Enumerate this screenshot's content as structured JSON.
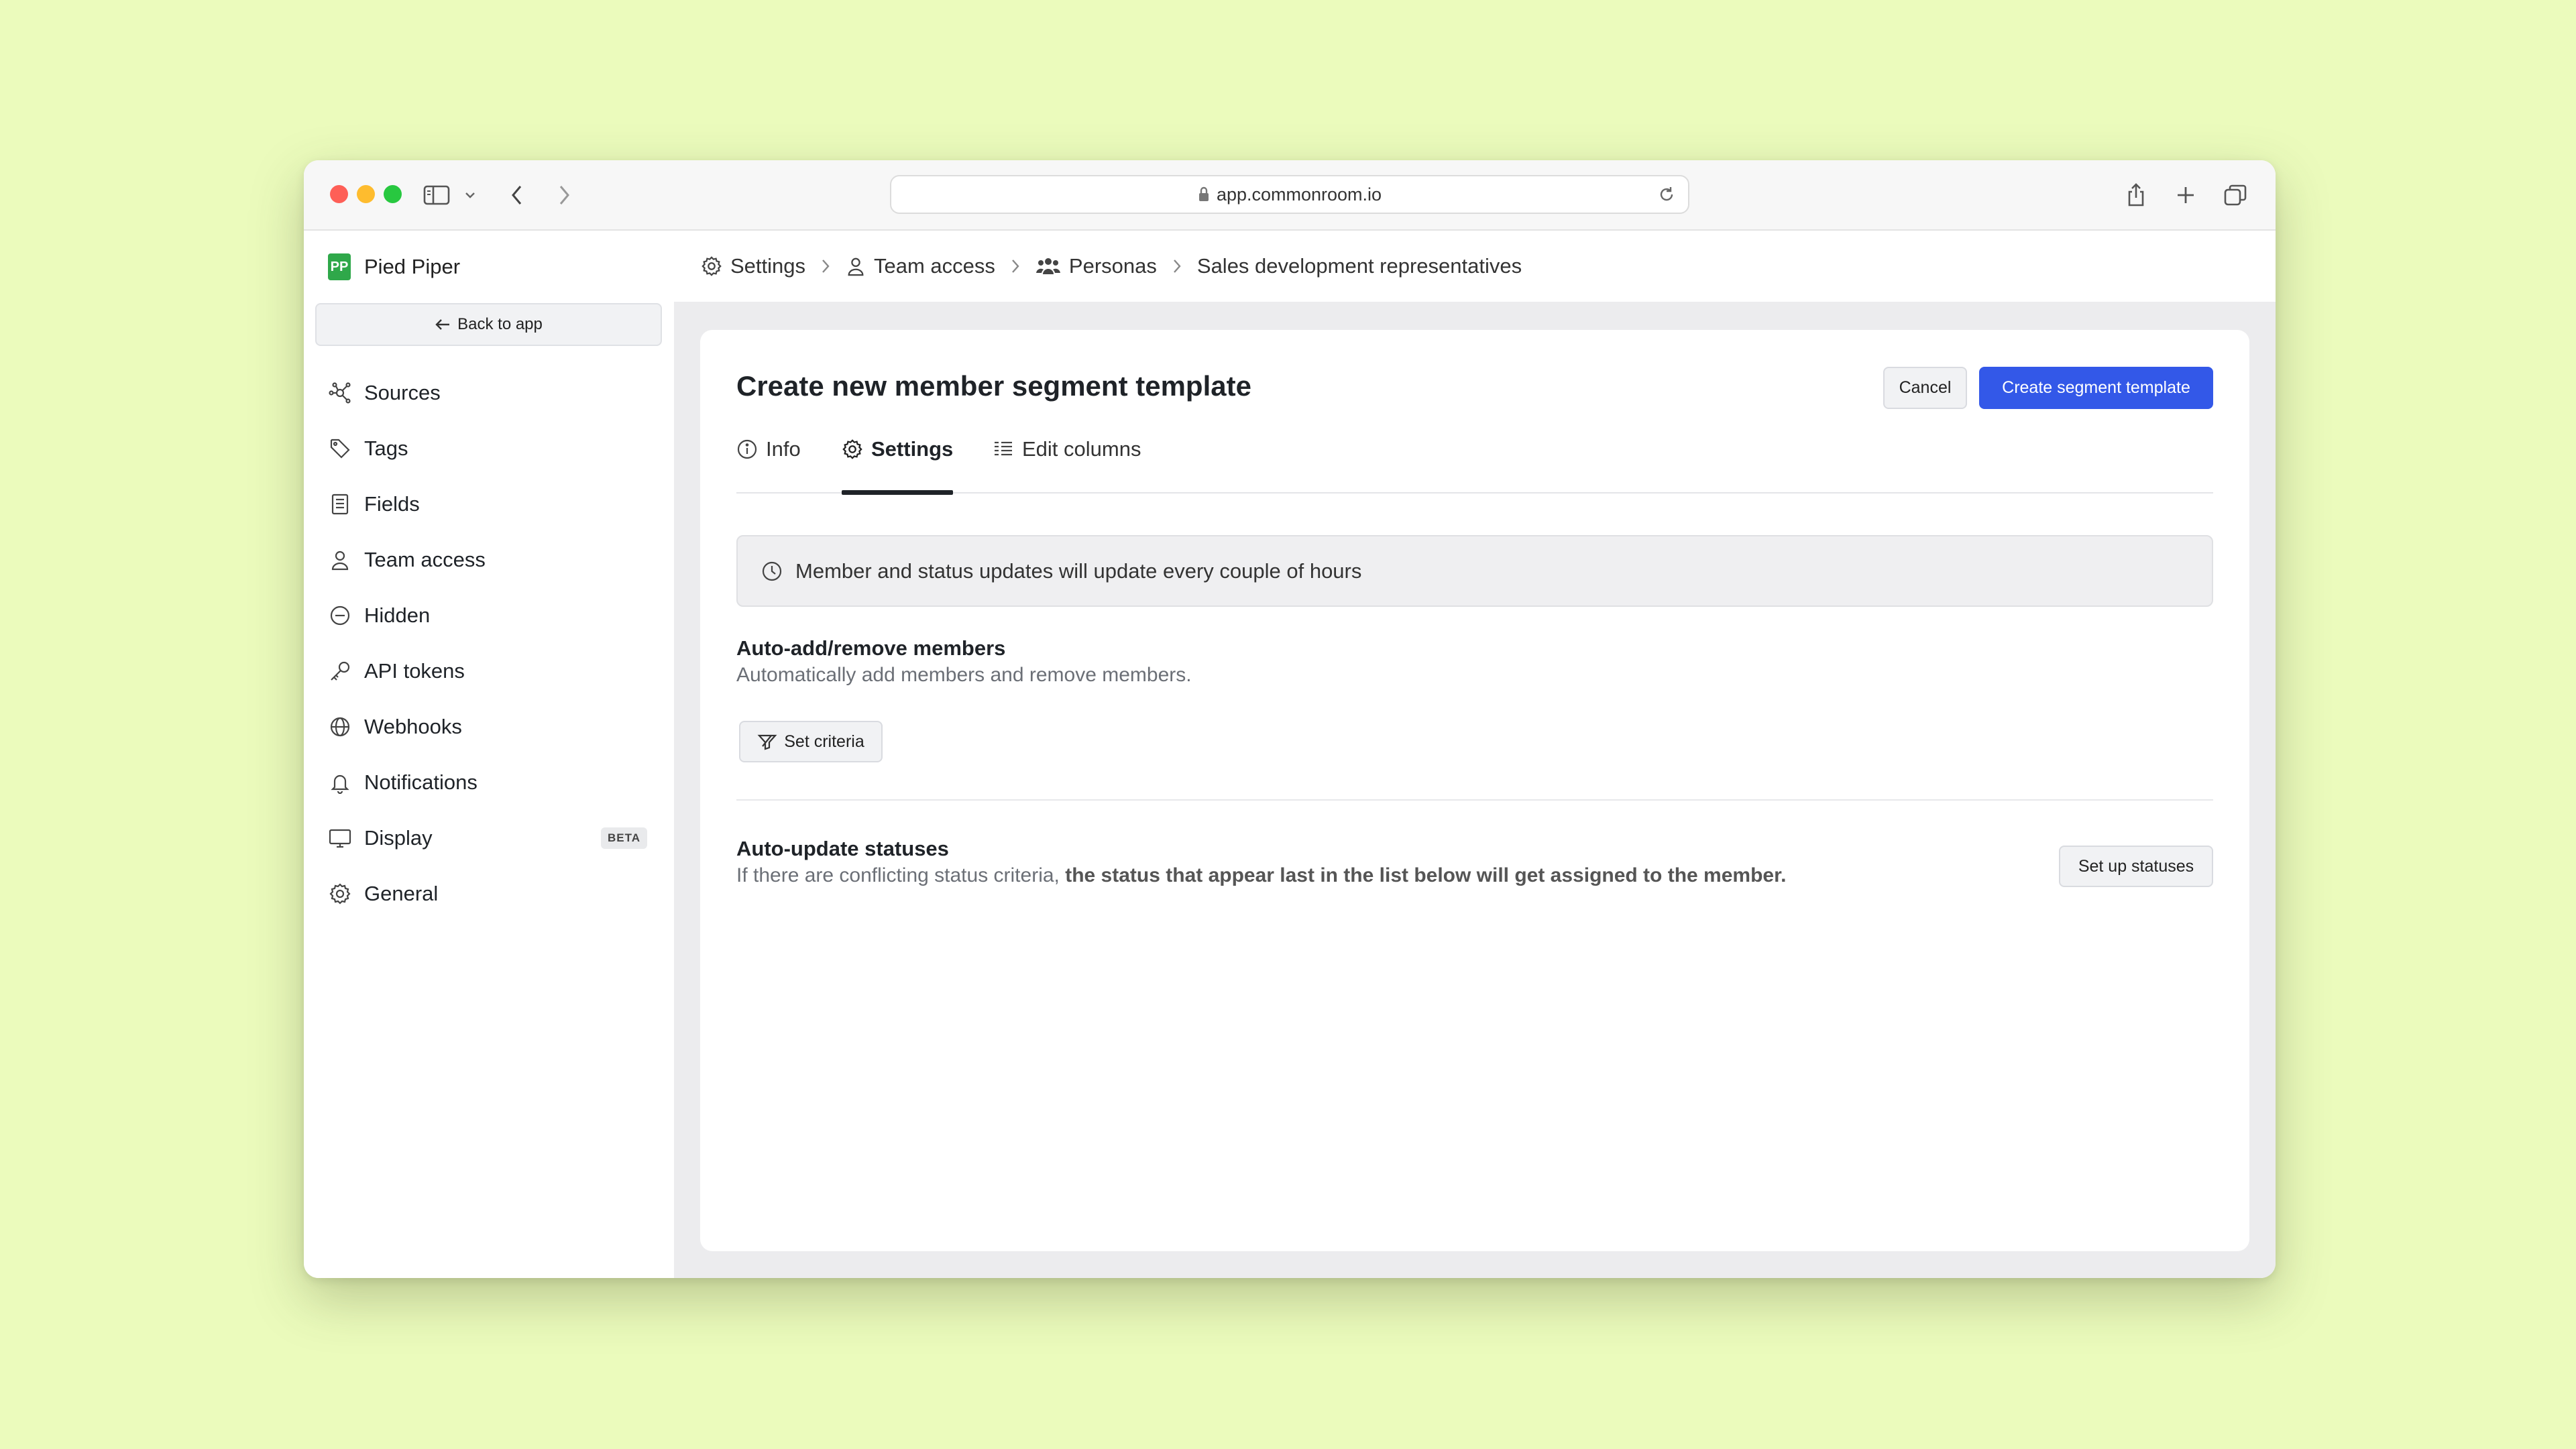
{
  "browser": {
    "url": "app.commonroom.io"
  },
  "sidebar": {
    "brand": "Pied Piper",
    "brand_logo_text": "PP",
    "back_label": "Back to app",
    "items": [
      {
        "label": "Sources",
        "icon": "sources-icon"
      },
      {
        "label": "Tags",
        "icon": "tag-icon"
      },
      {
        "label": "Fields",
        "icon": "fields-icon"
      },
      {
        "label": "Team access",
        "icon": "user-icon"
      },
      {
        "label": "Hidden",
        "icon": "hidden-icon"
      },
      {
        "label": "API tokens",
        "icon": "key-icon"
      },
      {
        "label": "Webhooks",
        "icon": "globe-icon"
      },
      {
        "label": "Notifications",
        "icon": "bell-icon"
      },
      {
        "label": "Display",
        "icon": "monitor-icon",
        "badge": "BETA"
      },
      {
        "label": "General",
        "icon": "gear-icon"
      }
    ]
  },
  "breadcrumb": {
    "items": [
      "Settings",
      "Team access",
      "Personas",
      "Sales development representatives"
    ]
  },
  "page": {
    "title": "Create new member segment template",
    "cancel_label": "Cancel",
    "create_label": "Create segment template",
    "tabs": [
      {
        "label": "Info",
        "icon": "info-icon"
      },
      {
        "label": "Settings",
        "icon": "gear-icon",
        "active": true
      },
      {
        "label": "Edit columns",
        "icon": "columns-icon"
      }
    ],
    "notice": "Member and status updates will update every couple of hours",
    "auto_add": {
      "title": "Auto-add/remove members",
      "description": "Automatically add members and remove members.",
      "button": "Set criteria"
    },
    "auto_update": {
      "title": "Auto-update statuses",
      "description_plain": "If there are conflicting status criteria, ",
      "description_bold": "the status that appear last in the list below will get assigned to the member.",
      "button": "Set up statuses"
    }
  },
  "colors": {
    "background": "#ebfbbc",
    "primary": "#3358e8",
    "panel": "#ececee"
  }
}
